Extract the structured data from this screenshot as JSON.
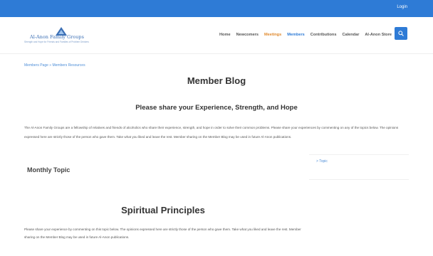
{
  "topbar": {
    "login_label": "Login"
  },
  "logo": {
    "wordmark": "Al-Anon Family Groups",
    "tagline": "Strength and Hope for Friends and Families of Problem Drinkers"
  },
  "nav": {
    "items": [
      {
        "label": "Home"
      },
      {
        "label": "Newcomers"
      },
      {
        "label": "Meetings"
      },
      {
        "label": "Members"
      },
      {
        "label": "Contributions"
      },
      {
        "label": "Calendar"
      },
      {
        "label": "Al-Anon Store"
      }
    ]
  },
  "breadcrumb": "Members Page » Members Resources",
  "page_title": "Member Blog",
  "subtitle": "Please share your Experience, Strength, and Hope",
  "intro": "The Al-Anon Family Groups are a fellowship of relatives and friends of alcoholics who share their experience, strength, and hope in order to solve their common problems. Please share your experiences by commenting on any of the topics below. The opinions expressed here are strictly those of the person who gave them. Take what you liked and leave the rest. Member sharing on the Member Blog may be used in future Al-Anon publications.",
  "monthly_topic": "Monthly Topic",
  "sidebar": {
    "link": "> Topic"
  },
  "section_title": "Spiritual Principles",
  "body_text": "Please share your experience by commenting on this topic below. The opinions expressed here are strictly those of the person who gave them. Take what you liked and leave the rest. Member sharing on the Member Blog may be used in future Al-Anon publications.",
  "colors": {
    "accent": "#2e7bd6",
    "nav_orange": "#e08a2e",
    "link": "#4f8fd8"
  }
}
